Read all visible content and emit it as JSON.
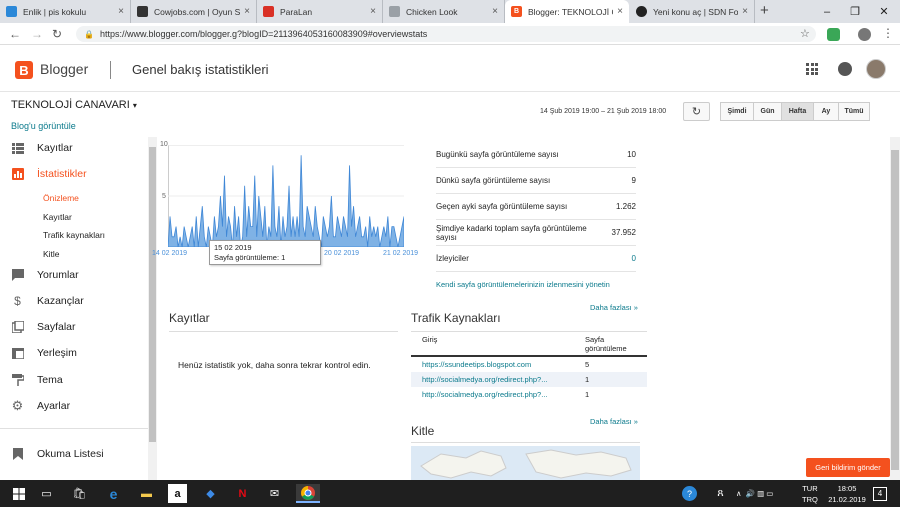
{
  "browser": {
    "tabs": [
      {
        "title": "Enlik | pis kokulu",
        "fav_color": "#2b88d8",
        "active": false
      },
      {
        "title": "Cowjobs.com | Oyun Se",
        "fav_color": "#333333",
        "active": false
      },
      {
        "title": "ParaLan",
        "fav_color": "#d93025",
        "active": false
      },
      {
        "title": "Chicken Look",
        "fav_color": "#9aa0a6",
        "active": false
      },
      {
        "title": "Blogger: TEKNOLOJİ CA",
        "fav_color": "#f4511e",
        "active": true
      },
      {
        "title": "Yeni konu aç | SDN Foru",
        "fav_color": "#222222",
        "active": false
      }
    ],
    "url": "https://www.blogger.com/blogger.g?blogID=2113964053160083909#overviewstats"
  },
  "header": {
    "logo_letter": "B",
    "app_name": "Blogger",
    "page_title": "Genel bakış istatistikleri"
  },
  "blog": {
    "title": "TEKNOLOJİ CANAVARI",
    "view_link": "Blog'u görüntüle"
  },
  "controls": {
    "date_range": "14 Şub 2019 19:00 – 21 Şub 2019 18:00",
    "buttons": [
      "Şimdi",
      "Gün",
      "Hafta",
      "Ay",
      "Tümü"
    ],
    "selected": "Hafta"
  },
  "sidebar": {
    "items": [
      {
        "label": "Kayıtlar",
        "icon": "posts-icon"
      },
      {
        "label": "İstatistikler",
        "icon": "stats-icon"
      },
      {
        "label": "Yorumlar",
        "icon": "comments-icon"
      },
      {
        "label": "Kazançlar",
        "icon": "dollar-icon"
      },
      {
        "label": "Sayfalar",
        "icon": "pages-icon"
      },
      {
        "label": "Yerleşim",
        "icon": "layout-icon"
      },
      {
        "label": "Tema",
        "icon": "paint-roller-icon"
      },
      {
        "label": "Ayarlar",
        "icon": "gear-icon"
      },
      {
        "label": "Okuma Listesi",
        "icon": "bookmark-icon"
      }
    ],
    "subitems": [
      "Önizleme",
      "Kayıtlar",
      "Trafik kaynakları",
      "Kitle"
    ]
  },
  "chart_data": {
    "type": "area",
    "yticks": [
      "10",
      "5"
    ],
    "ylim": [
      0,
      10
    ],
    "xticks": [
      "14 02 2019",
      "20 02 2019",
      "21 02 2019"
    ],
    "values": [
      0,
      3,
      1,
      1,
      2,
      0,
      1,
      0,
      2,
      1,
      0,
      1,
      2,
      0,
      3,
      0,
      2,
      4,
      1,
      0,
      2,
      1,
      0,
      3,
      1,
      2,
      5,
      2,
      7,
      1,
      3,
      2,
      0,
      4,
      1,
      3,
      0,
      1,
      6,
      1,
      4,
      2,
      2,
      7,
      1,
      5,
      3,
      1,
      4,
      0,
      2,
      1,
      8,
      2,
      1,
      4,
      0,
      3,
      1,
      2,
      6,
      1,
      3,
      1,
      3,
      1,
      9,
      2,
      1,
      4,
      3,
      2,
      1,
      4,
      2,
      1,
      0,
      3,
      2,
      1,
      2,
      5,
      1,
      1,
      3,
      2,
      1,
      3,
      2,
      1,
      8,
      2,
      4,
      1,
      2,
      3,
      1,
      1,
      2,
      0,
      3,
      1,
      2,
      1,
      2,
      0,
      1,
      2,
      1,
      3,
      0,
      2,
      2,
      1,
      0,
      1,
      2,
      3
    ],
    "tooltip": {
      "date": "15 02 2019",
      "text": "Sayfa görüntüleme: 1"
    }
  },
  "stats": [
    {
      "label": "Bugünkü sayfa görüntüleme sayısı",
      "value": "10"
    },
    {
      "label": "Dünkü sayfa görüntüleme sayısı",
      "value": "9"
    },
    {
      "label": "Geçen ayki sayfa görüntüleme sayısı",
      "value": "1.262"
    },
    {
      "label": "Şimdiye kadarki toplam sayfa görüntüleme sayısı",
      "value": "37.952"
    },
    {
      "label": "İzleyiciler",
      "value": "0"
    }
  ],
  "follow_link": "Kendi sayfa görüntülemelerinizin izlenmesini yönetin",
  "more_label": "Daha fazlası »",
  "posts_section": {
    "title": "Kayıtlar",
    "empty": "Henüz istatistik yok, daha sonra tekrar kontrol edin."
  },
  "traffic": {
    "title": "Trafik Kaynakları",
    "col1": "Giriş",
    "col2": "Sayfa görüntüleme",
    "rows": [
      {
        "src": "https://ssundeetips.blogspot.com",
        "views": "5"
      },
      {
        "src": "http://socialmedya.org/redirect.php?...",
        "views": "1"
      },
      {
        "src": "http://socialmedya.org/redirect.php?...",
        "views": "1"
      }
    ]
  },
  "audience": {
    "title": "Kitle"
  },
  "feedback": "Geri bildirim gönder",
  "taskbar": {
    "lang1": "TUR",
    "lang2": "TRQ",
    "time": "18:05",
    "date": "21.02.2019",
    "badge": "4"
  }
}
